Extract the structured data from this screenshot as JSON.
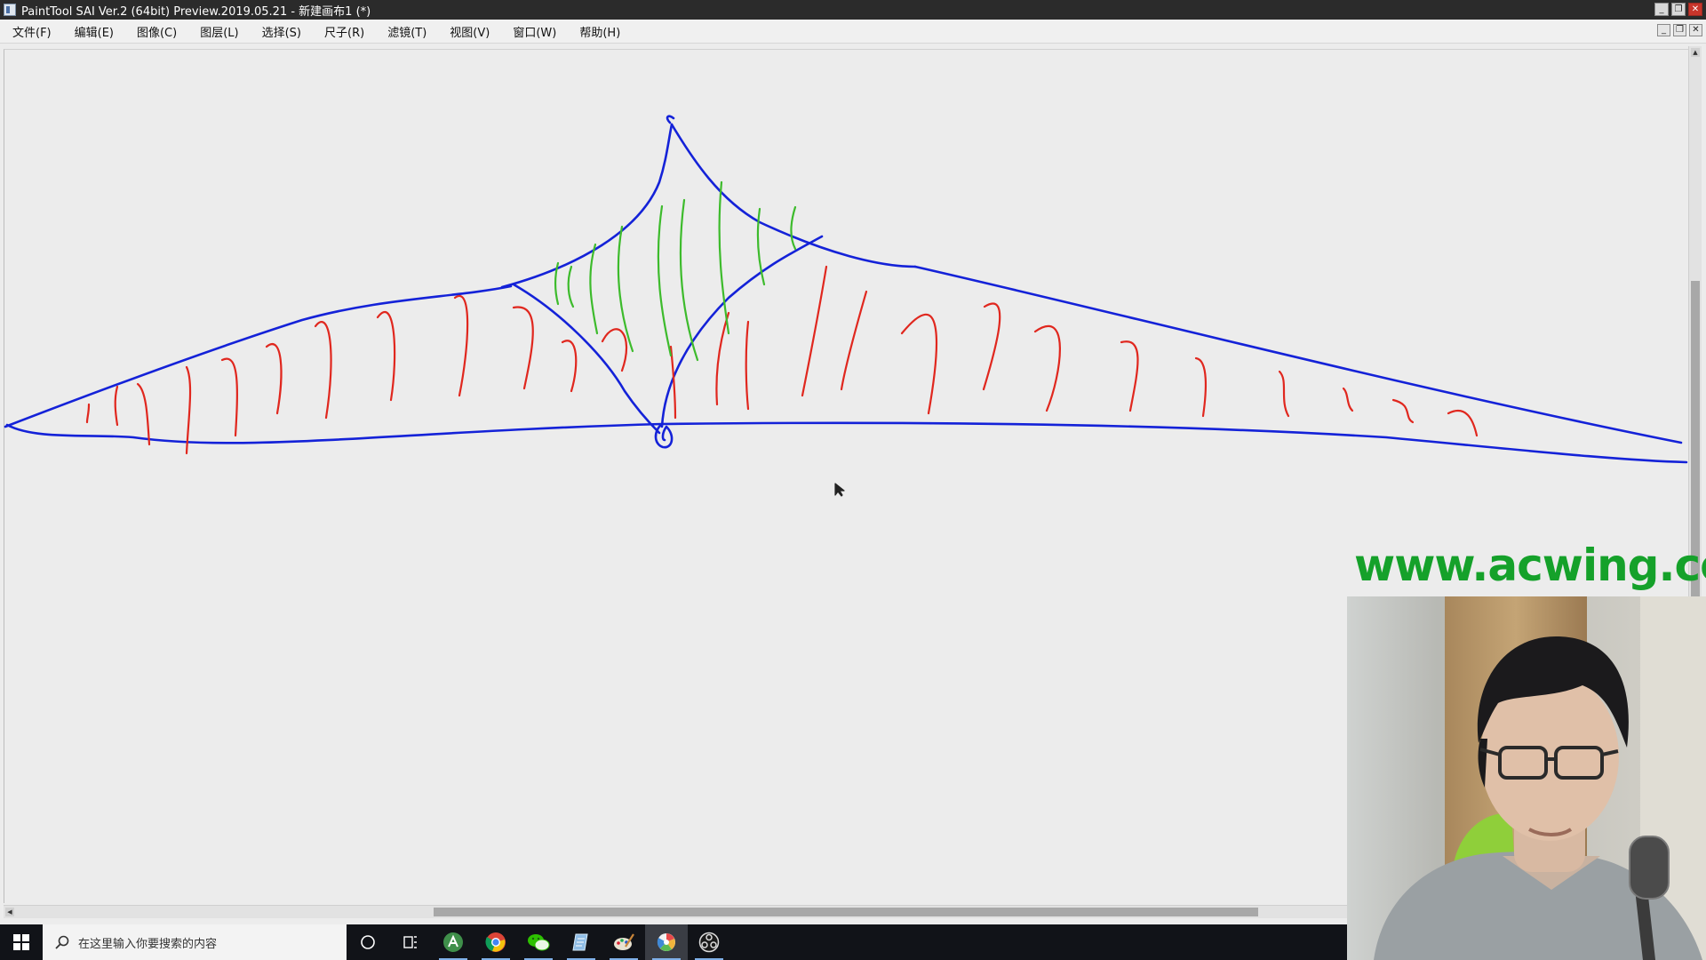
{
  "window": {
    "title": "PaintTool SAI Ver.2 (64bit) Preview.2019.05.21 - 新建画布1 (*)",
    "buttons": [
      "minimize",
      "restore",
      "close"
    ]
  },
  "menu": {
    "items": [
      "文件(F)",
      "编辑(E)",
      "图像(C)",
      "图层(L)",
      "选择(S)",
      "尺子(R)",
      "滤镜(T)",
      "视图(V)",
      "窗口(W)",
      "帮助(H)"
    ]
  },
  "watermark": {
    "text": "www.acwing.com",
    "color": "#15a12a"
  },
  "taskbar": {
    "search_placeholder": "在这里输入你要搜索的内容",
    "icons": [
      "windows-start-icon",
      "search-icon",
      "cortana-icon",
      "task-view-icon",
      "android-studio-icon",
      "chrome-icon",
      "wechat-icon",
      "notepad-icon",
      "paint-app-icon",
      "painttool-sai-icon",
      "obs-icon"
    ]
  },
  "colors": {
    "stroke_blue": "#1422d8",
    "stroke_red": "#e0271e",
    "stroke_green": "#3dbb2c",
    "taskbar": "#111318",
    "titlebar": "#2b2b2b"
  },
  "webcam": {
    "content": "presenter-video"
  }
}
